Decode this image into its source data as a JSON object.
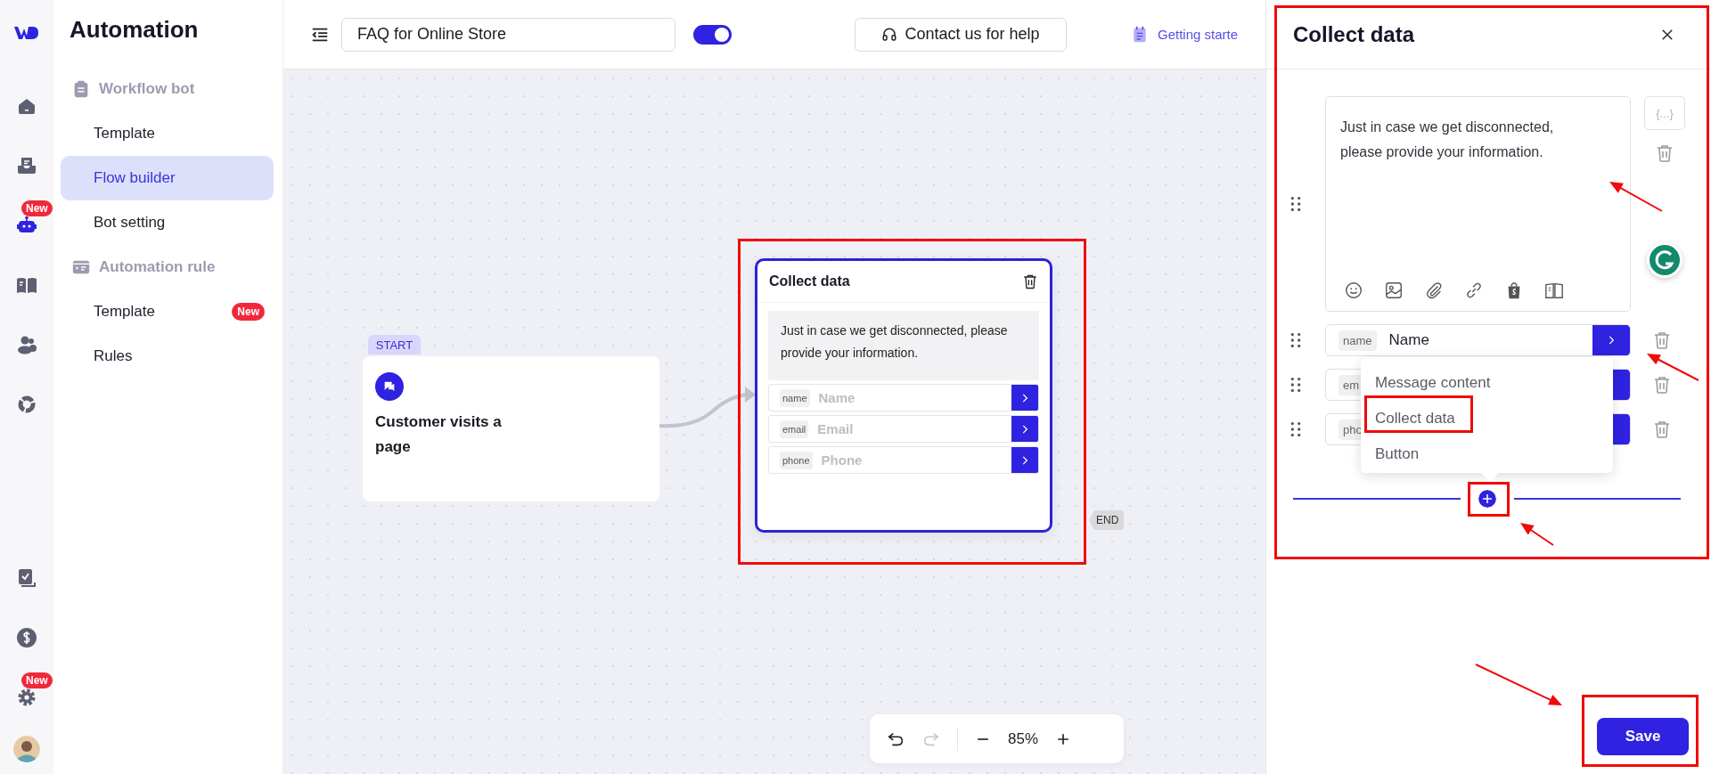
{
  "nav_rail": {
    "top": [
      {
        "selected": false
      },
      {
        "selected": false
      },
      {
        "selected": true,
        "badge": "New"
      },
      {
        "selected": false
      },
      {
        "selected": false
      },
      {
        "selected": false
      }
    ],
    "bottom": [
      {
        "selected": false
      },
      {
        "selected": false
      },
      {
        "selected": false,
        "badge": "New"
      }
    ]
  },
  "sidebar": {
    "title": "Automation",
    "sections": [
      {
        "label": "Workflow bot",
        "items": [
          {
            "label": "Template",
            "selected": false
          },
          {
            "label": "Flow builder",
            "selected": true
          },
          {
            "label": "Bot setting",
            "selected": false
          }
        ]
      },
      {
        "label": "Automation rule",
        "items": [
          {
            "label": "Template",
            "selected": false,
            "badge": "New"
          },
          {
            "label": "Rules",
            "selected": false
          }
        ]
      }
    ]
  },
  "toolbar": {
    "flow_name": "FAQ for Online Store",
    "enabled": true,
    "help_button": "Contact us for help",
    "getting_started": "Getting starte"
  },
  "canvas": {
    "start_node": {
      "tag": "START",
      "title": "Customer visits a page"
    },
    "node": {
      "title": "Collect data",
      "message": "Just in case we get disconnected, please provide your information.",
      "fields": [
        {
          "tag": "name",
          "placeholder": "Name"
        },
        {
          "tag": "email",
          "placeholder": "Email"
        },
        {
          "tag": "phone",
          "placeholder": "Phone"
        }
      ]
    },
    "end_tag": "END",
    "zoom_controls": {
      "undo": {
        "disabled": false
      },
      "redo": {
        "disabled": true
      },
      "zoom": "85%"
    }
  },
  "panel": {
    "title": "Collect data",
    "message": "Just in case we get disconnected, please provide your information.",
    "variable_button": "{...}",
    "fields": [
      {
        "tag": "name",
        "value": "Name"
      },
      {
        "tag": "em"
      },
      {
        "tag": "pho"
      }
    ],
    "menu": [
      "Message content",
      "Collect data",
      "Button"
    ],
    "save_button": "Save"
  }
}
